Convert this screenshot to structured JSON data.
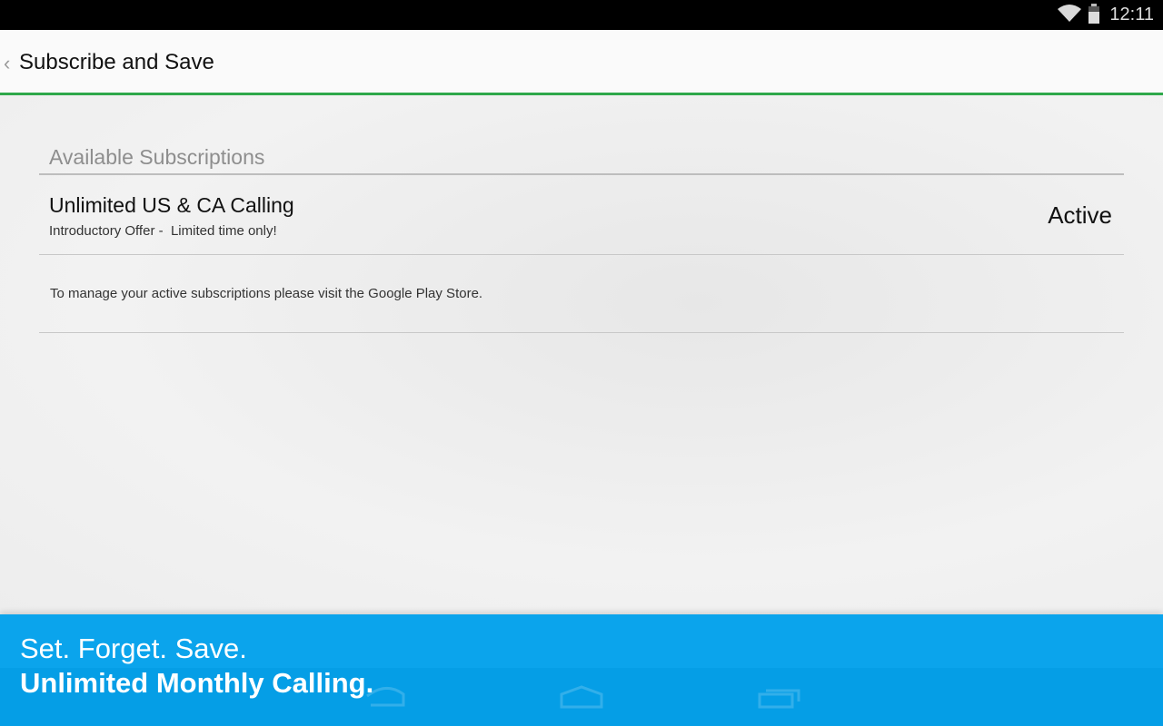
{
  "status_bar": {
    "time": "12:11",
    "icons": [
      "wifi-icon",
      "battery-icon"
    ]
  },
  "action_bar": {
    "back_icon": "chevron-left-icon",
    "title": "Subscribe and Save",
    "accent_color": "#2ea84a"
  },
  "section": {
    "header": "Available Subscriptions"
  },
  "subscriptions": [
    {
      "name": "Unlimited US & CA Calling",
      "description": "Introductory Offer -  Limited time only!",
      "status": "Active"
    }
  ],
  "note": "To manage your active subscriptions please visit the Google Play Store.",
  "promo": {
    "line1": "Set. Forget. Save.",
    "line2": "Unlimited Monthly Calling.",
    "background_color": "#0ba4ec"
  },
  "nav_bar": {
    "icons": [
      "back-nav-icon",
      "home-nav-icon",
      "recents-nav-icon"
    ]
  }
}
